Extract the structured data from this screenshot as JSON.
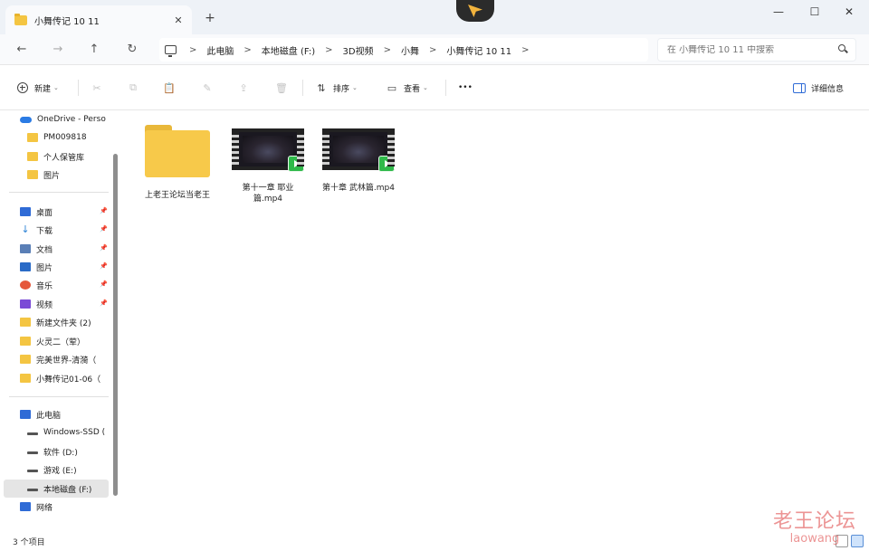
{
  "window": {
    "tab_title": "小舞传记 10 11",
    "tab_close": "✕",
    "new_tab": "+",
    "minimize": "—",
    "maximize": "☐",
    "close": "✕"
  },
  "nav": {
    "back": "←",
    "forward": "→",
    "up": "↑",
    "refresh": "↻",
    "breadcrumbs": [
      "此电脑",
      "本地磁盘 (F:)",
      "3D视频",
      "小舞",
      "小舞传记 10 11"
    ],
    "separator": ">",
    "search_placeholder": "在 小舞传记 10 11 中搜索"
  },
  "commands": {
    "new_label": "新建",
    "sort_label": "排序",
    "view_label": "查看",
    "more_label": "•••",
    "details_label": "详细信息",
    "caret": "⌄"
  },
  "sidebar": {
    "onedrive": "OneDrive - Perso",
    "onedrive_items": [
      "PM009818",
      "个人保管库",
      "图片"
    ],
    "quick_access": [
      {
        "label": "桌面",
        "icon": "desktop-icon",
        "pinned": true
      },
      {
        "label": "下载",
        "icon": "download-icon",
        "pinned": true
      },
      {
        "label": "文档",
        "icon": "documents-icon",
        "pinned": true
      },
      {
        "label": "图片",
        "icon": "pictures-icon",
        "pinned": true
      },
      {
        "label": "音乐",
        "icon": "music-icon",
        "pinned": true
      },
      {
        "label": "视频",
        "icon": "videos-icon",
        "pinned": true
      },
      {
        "label": "新建文件夹 (2)",
        "icon": "folder-icon",
        "pinned": false
      },
      {
        "label": "火灵二（荤）",
        "icon": "folder-icon",
        "pinned": false
      },
      {
        "label": "完美世界-清漪（",
        "icon": "folder-icon",
        "pinned": false
      },
      {
        "label": "小舞传记01-06（",
        "icon": "folder-icon",
        "pinned": false
      }
    ],
    "pin_glyph": "📌",
    "this_pc": "此电脑",
    "drives": [
      "Windows-SSD (",
      "软件 (D:)",
      "游戏 (E:)",
      "本地磁盘 (F:)"
    ],
    "network": "网络"
  },
  "files": [
    {
      "name": "上老王论坛当老王",
      "type": "folder"
    },
    {
      "name": "第十一章 耶业篇.mp4",
      "type": "video"
    },
    {
      "name": "第十章 武林篇.mp4",
      "type": "video"
    }
  ],
  "status": {
    "item_count": "3 个项目"
  },
  "watermark": {
    "cn": "老王论坛",
    "en": "laowang"
  },
  "colors": {
    "accent": "#2f6bd6",
    "folder": "#f4c542",
    "play_badge": "#2fb94a"
  }
}
